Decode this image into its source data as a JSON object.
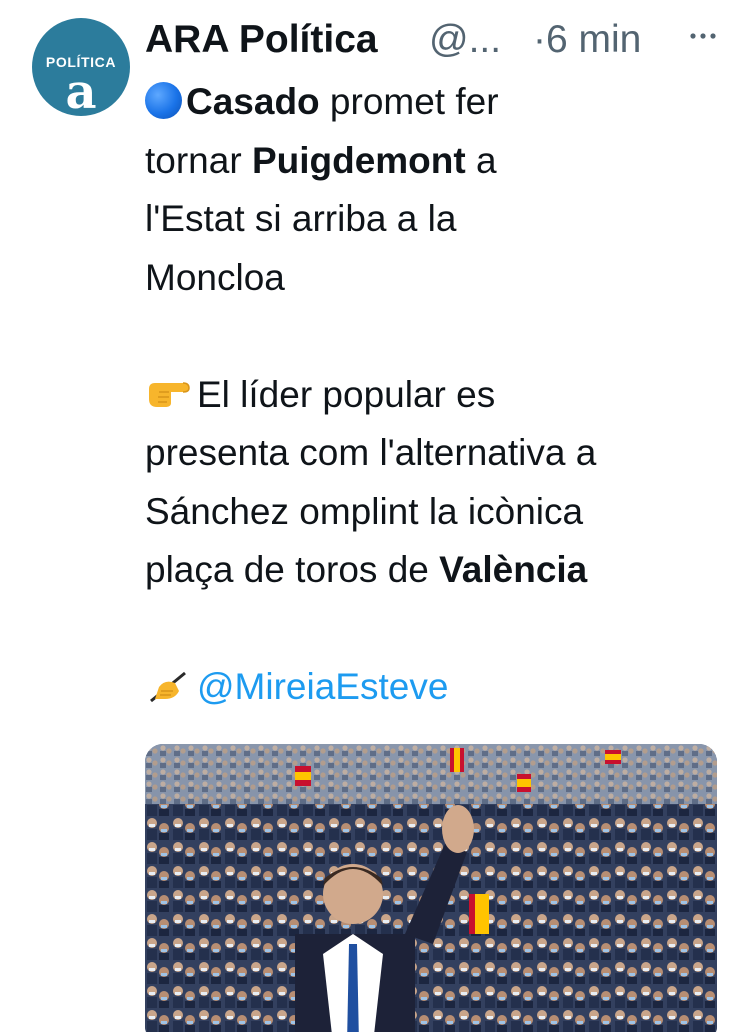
{
  "tweet": {
    "avatar": {
      "label": "POLÍTICA",
      "logo": "a",
      "color": "#2c7c9c",
      "icon": "ara-politica-logo"
    },
    "author": {
      "display_name": "ARA Política",
      "handle": "@...",
      "timestamp": "·6 min"
    },
    "more_icon": "more-dots-icon",
    "text": {
      "line1_emoji": "blue-circle-icon",
      "line1_bold": "Casado",
      "line1_rest": " promet fer",
      "line2_pre": "tornar ",
      "line2_bold": "Puigdemont",
      "line2_post": " a",
      "line3": "l'Estat si arriba a la",
      "line4": "Moncloa",
      "line5_emoji": "pointing-right-hand-icon",
      "line5_rest": "El líder popular es",
      "line6": "presenta com l'alternativa a",
      "line7": "Sánchez omplint la icònica",
      "line8_pre": "plaça de toros de ",
      "line8_bold": "València",
      "line9_emoji": "writing-hand-icon",
      "mention": "@MireiaEsteve"
    },
    "media": {
      "description_icon": "crowd-photo",
      "colors": {
        "mention": "#1d9bf0",
        "muted": "#536471",
        "text": "#0f1419"
      }
    }
  }
}
